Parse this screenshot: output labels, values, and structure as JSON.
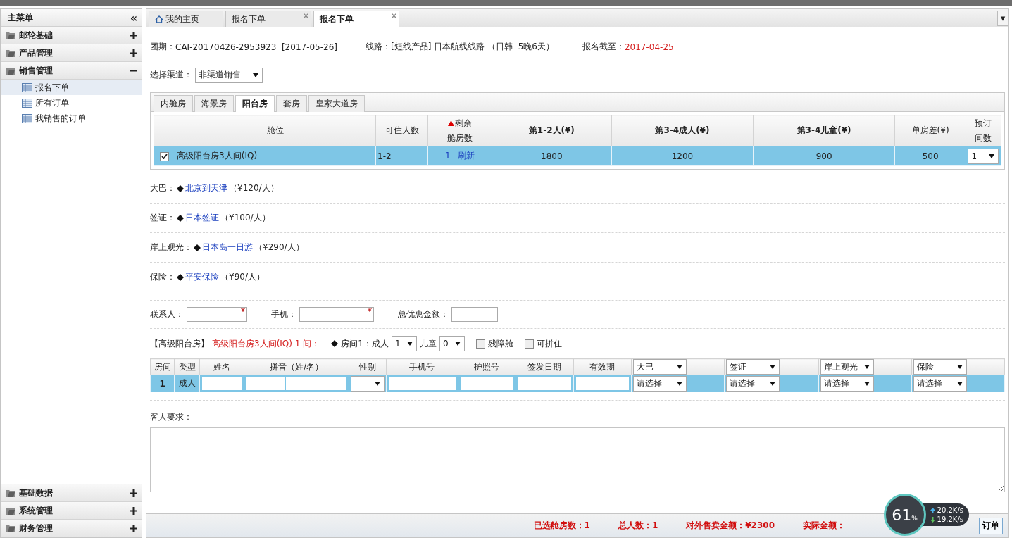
{
  "sidebar": {
    "title": "主菜单",
    "collapse": "«",
    "top_groups": [
      {
        "label": "邮轮基础",
        "expanded": false
      },
      {
        "label": "产品管理",
        "expanded": false
      },
      {
        "label": "销售管理",
        "expanded": true,
        "children": [
          {
            "label": "报名下单",
            "selected": true
          },
          {
            "label": "所有订单",
            "selected": false
          },
          {
            "label": "我销售的订单",
            "selected": false
          }
        ]
      }
    ],
    "bottom_groups": [
      {
        "label": "基础数据",
        "expanded": false
      },
      {
        "label": "系统管理",
        "expanded": false
      },
      {
        "label": "财务管理",
        "expanded": false
      }
    ]
  },
  "tabs": [
    {
      "label": "我的主页",
      "kind": "home",
      "selected": false
    },
    {
      "label": "报名下单",
      "kind": "closable",
      "selected": false
    },
    {
      "label": "报名下单",
      "kind": "closable",
      "selected": true
    }
  ],
  "tab_menu": "▾",
  "info": {
    "period_label": "团期：",
    "period": "CAI-20170426-2953923  [2017-05-26]",
    "route_label": "线路：",
    "route": "[短线产品] 日本航线线路 （日韩  5晚6天）",
    "deadline_label": "报名截至：",
    "deadline": "2017-04-25"
  },
  "channel": {
    "label": "选择渠道：",
    "value": "非渠道销售"
  },
  "room_tabs": [
    {
      "label": "内舱房",
      "selected": false
    },
    {
      "label": "海景房",
      "selected": false
    },
    {
      "label": "阳台房",
      "selected": true
    },
    {
      "label": "套房",
      "selected": false
    },
    {
      "label": "皇家大道房",
      "selected": false
    }
  ],
  "cabin_table": {
    "columns": [
      {
        "lines": [
          "舱位"
        ],
        "bold": false
      },
      {
        "lines": [
          "可住人数"
        ],
        "bold": false
      },
      {
        "lines": [
          "剩余",
          "舱房数"
        ],
        "bold": false,
        "sorted": true
      },
      {
        "lines": [
          "第1-2人(¥)"
        ],
        "bold": true
      },
      {
        "lines": [
          "第3-4成人(¥)"
        ],
        "bold": true
      },
      {
        "lines": [
          "第3-4儿童(¥)"
        ],
        "bold": true
      },
      {
        "lines": [
          "单房差(¥)"
        ],
        "bold": false
      },
      {
        "lines": [
          "预订",
          "间数"
        ],
        "bold": false
      }
    ],
    "rows": [
      {
        "checked": true,
        "selected": true,
        "cabin": "高级阳台房3人间(IQ)",
        "capacity": "1-2",
        "remaining": "1",
        "refresh": "刷新",
        "price_1_2": "1800",
        "price_3_4_adult": "1200",
        "price_3_4_child": "900",
        "single_supplement": "500",
        "rooms": "1"
      }
    ]
  },
  "extras": [
    {
      "label": "大巴：",
      "item": "北京到天津",
      "price": "（¥120/人）"
    },
    {
      "label": "签证：",
      "item": "日本签证",
      "price": "（¥100/人）"
    },
    {
      "label": "岸上观光：",
      "item": "日本岛一日游",
      "price": "（¥290/人）"
    },
    {
      "label": "保险：",
      "item": "平安保险",
      "price": "（¥90/人）"
    }
  ],
  "contact": {
    "name_label": "联系人：",
    "phone_label": "手机：",
    "discount_label": "总优惠金额："
  },
  "room_line": {
    "type": "【高级阳台房】",
    "cabin": "高级阳台房3人间(IQ) 1 间：",
    "room": "房间1：成人",
    "adults": "1",
    "child_label": "儿童",
    "children": "0",
    "options": [
      {
        "label": "残障舱",
        "checked": false
      },
      {
        "label": "可拼住",
        "checked": false
      }
    ]
  },
  "guest_table": {
    "columns": [
      {
        "label": "房间",
        "kind": "text"
      },
      {
        "label": "类型",
        "kind": "text"
      },
      {
        "label": "姓名",
        "kind": "text"
      },
      {
        "label": "拼音（姓/名）",
        "kind": "text"
      },
      {
        "label": "性别",
        "kind": "text"
      },
      {
        "label": "手机号",
        "kind": "text"
      },
      {
        "label": "护照号",
        "kind": "text"
      },
      {
        "label": "签发日期",
        "kind": "text"
      },
      {
        "label": "有效期",
        "kind": "text"
      },
      {
        "label": "大巴",
        "kind": "select"
      },
      {
        "label": "签证",
        "kind": "select"
      },
      {
        "label": "岸上观光",
        "kind": "select"
      },
      {
        "label": "保险",
        "kind": "select"
      }
    ],
    "rows": [
      {
        "selected": true,
        "room": "1",
        "type": "成人",
        "choices": [
          "请选择",
          "请选择",
          "请选择",
          "请选择"
        ]
      }
    ]
  },
  "remarks_label": "客人要求：",
  "summary": [
    {
      "label": "已选舱房数：1"
    },
    {
      "label": "总人数：1"
    },
    {
      "label": "对外售卖金额：¥2300"
    },
    {
      "label": "实际金额："
    }
  ],
  "submit": "订单",
  "speed_widget": {
    "percent": "61",
    "unit": "%",
    "up": "20.2",
    "up_unit": "K/s",
    "down": "19.2",
    "down_unit": "K/s"
  }
}
